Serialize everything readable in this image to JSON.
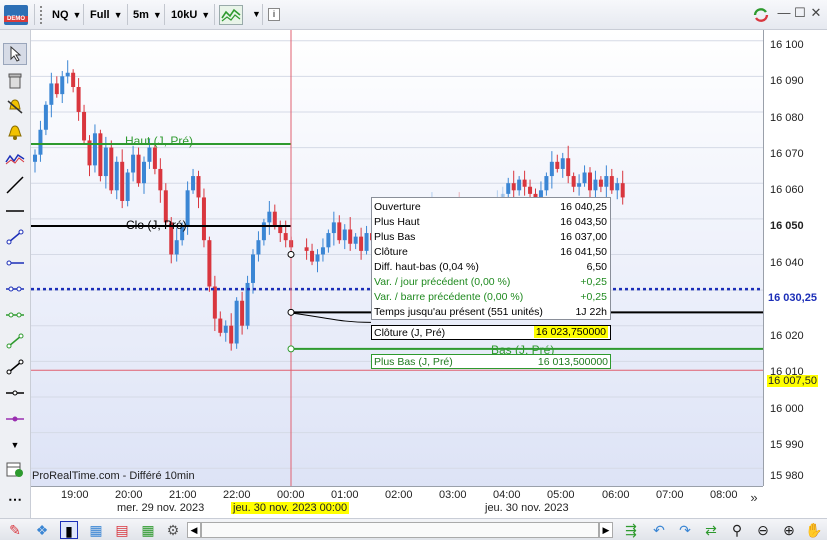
{
  "toolbar": {
    "badge": "DEMO",
    "instrument": "NQ",
    "range": "Full",
    "interval": "5m",
    "units": "10kU",
    "info_icon": "i"
  },
  "price_axis": {
    "ticks": [
      "16 100",
      "16 090",
      "16 080",
      "16 070",
      "16 060",
      "16 050",
      "16 040",
      "16 020",
      "16 010",
      "16 000",
      "15 990",
      "15 980"
    ],
    "current_price": "16 030,25",
    "cursor_price": "16 007,50"
  },
  "time_axis": {
    "ticks": [
      "19:00",
      "20:00",
      "21:00",
      "22:00",
      "00:00",
      "01:00",
      "02:00",
      "03:00",
      "04:00",
      "05:00",
      "06:00",
      "07:00",
      "08:00"
    ],
    "date_left": "mer. 29 nov. 2023",
    "cursor_date": "jeu. 30 nov. 2023 00:00",
    "date_right": "jeu. 30 nov. 2023",
    "more": "»"
  },
  "chart": {
    "watermark": "ProRealTime.com - Différé 10min",
    "label_high_prev": "Haut (J, Pré)",
    "label_close_prev": "Clo (J, Pré)",
    "label_low_prev": "Bas (J, Pré)"
  },
  "info_box": {
    "rows": [
      {
        "k": "Ouverture",
        "v": "16 040,25"
      },
      {
        "k": "Plus Haut",
        "v": "16 043,50"
      },
      {
        "k": "Plus Bas",
        "v": "16 037,00"
      },
      {
        "k": "Clôture",
        "v": "16 041,50"
      },
      {
        "k": "Diff. haut-bas (0,04 %)",
        "v": "6,50"
      },
      {
        "k": "Var. / jour précédent (0,00 %)",
        "v": "+0,25"
      },
      {
        "k": "Var. / barre précédente (0,00 %)",
        "v": "+0,25"
      },
      {
        "k": "Temps jusqu'au présent (551 unités)",
        "v": "1J 22h"
      }
    ]
  },
  "tags": {
    "close_prev_label": "Clôture (J, Pré)",
    "close_prev_value": "16 023,750000",
    "low_prev_label": "Plus Bas (J, Pré)",
    "low_prev_value": "16 013,500000"
  },
  "colors": {
    "up": "#3b86d4",
    "down": "#d9363e",
    "high_line": "#2e9a2e",
    "close_line": "#000000",
    "current_line": "#1c2fb8",
    "cursor_line": "#e06070",
    "highlight": "#ffff00"
  },
  "chart_data": {
    "type": "candlestick",
    "ylim": [
      15975,
      16103
    ],
    "reference_levels": {
      "high_prev": 16071,
      "close_prev": 16023.75,
      "low_prev": 16013.5,
      "current": 16030.25,
      "cursor": 16007.5,
      "line_close": 16048
    },
    "closes": [
      16068,
      16075,
      16082,
      16088,
      16085,
      16090,
      16091,
      16087,
      16080,
      16072,
      16065,
      16074,
      16062,
      16070,
      16058,
      16066,
      16055,
      16063,
      16068,
      16060,
      16066,
      16070,
      16064,
      16058,
      16049,
      16040,
      16044,
      16048,
      16058,
      16062,
      16056,
      16044,
      16031,
      16022,
      16018,
      16020,
      16015,
      16027,
      16020,
      16032,
      16040,
      16044,
      16049,
      16052,
      16048,
      16046,
      16044,
      16042,
      16041,
      16038,
      16040,
      16042,
      16046,
      16049,
      16044,
      16047,
      16043,
      16045,
      16041,
      16046,
      16044,
      16042,
      16045,
      16047,
      16045,
      16044,
      16046,
      16049,
      16047,
      16050,
      16052,
      16055,
      16053,
      16050,
      16052,
      16054,
      16051,
      16049,
      16048,
      16050,
      16052,
      16051,
      16053,
      16055,
      16057,
      16060,
      16058,
      16061,
      16059,
      16057,
      16055,
      16058,
      16062,
      16066,
      16064,
      16067,
      16062,
      16059,
      16060,
      16063,
      16058,
      16061,
      16059,
      16062,
      16058,
      16060,
      16056
    ]
  }
}
